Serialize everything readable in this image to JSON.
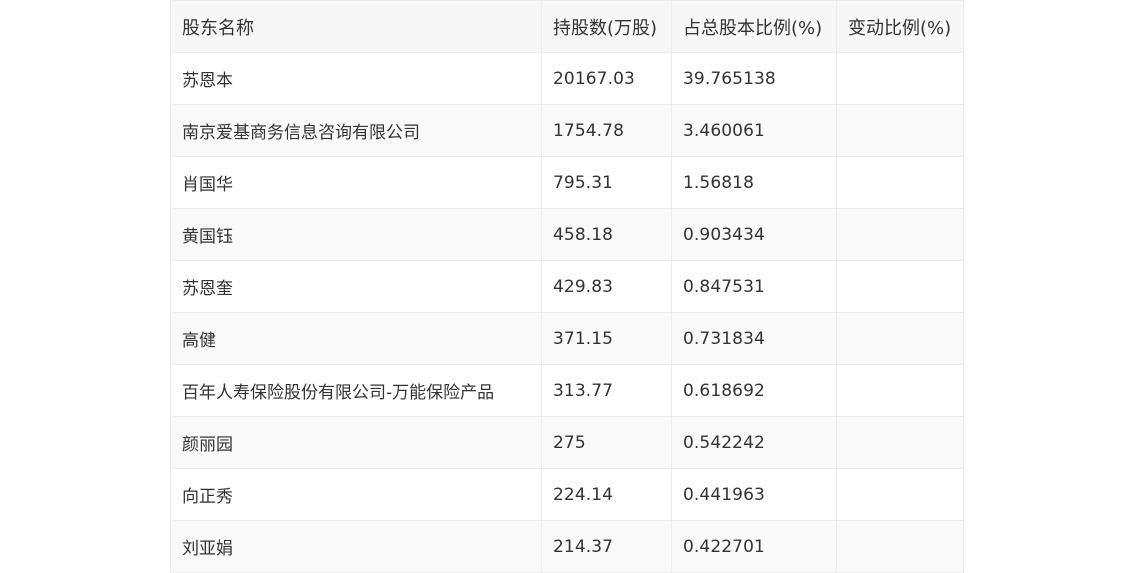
{
  "table": {
    "headers": [
      "股东名称",
      "持股数(万股)",
      "占总股本比例(%)",
      "变动比例(%)"
    ],
    "rows": [
      [
        "苏恩本",
        "20167.03",
        "39.765138",
        ""
      ],
      [
        "南京爱基商务信息咨询有限公司",
        "1754.78",
        "3.460061",
        ""
      ],
      [
        "肖国华",
        "795.31",
        "1.56818",
        ""
      ],
      [
        "黄国钰",
        "458.18",
        "0.903434",
        ""
      ],
      [
        "苏恩奎",
        "429.83",
        "0.847531",
        ""
      ],
      [
        "高健",
        "371.15",
        "0.731834",
        ""
      ],
      [
        "百年人寿保险股份有限公司-万能保险产品",
        "313.77",
        "0.618692",
        ""
      ],
      [
        "颜丽园",
        "275",
        "0.542242",
        ""
      ],
      [
        "向正秀",
        "224.14",
        "0.441963",
        ""
      ],
      [
        "刘亚娟",
        "214.37",
        "0.422701",
        ""
      ]
    ]
  }
}
